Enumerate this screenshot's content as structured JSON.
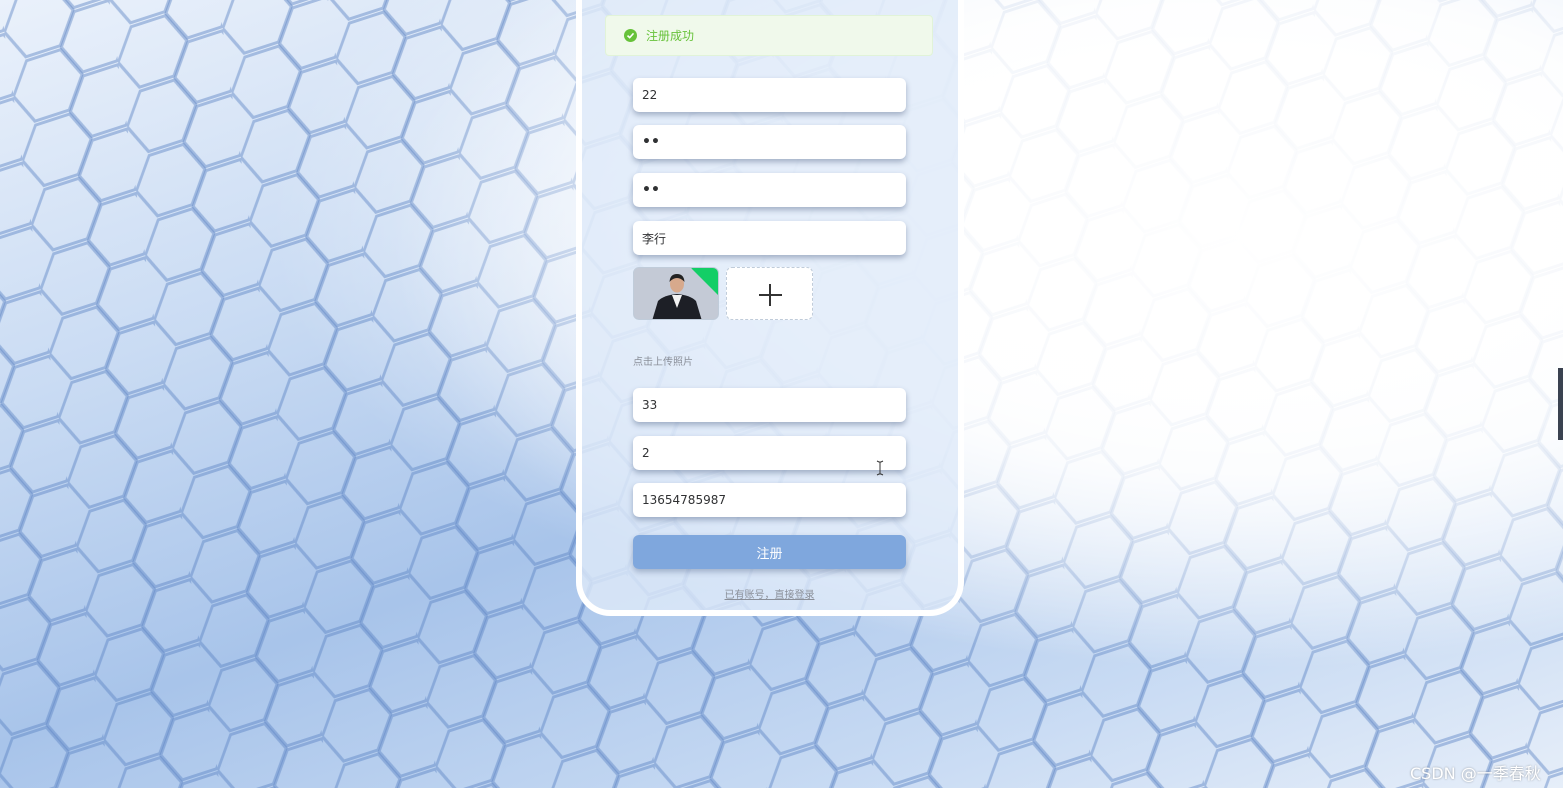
{
  "alert": {
    "message": "注册成功",
    "icon": "check-circle-icon"
  },
  "form": {
    "username_value": "22",
    "password_value": "••",
    "confirm_password_value": "••",
    "name_value": "李行",
    "upload_hint": "点击上传照片",
    "age_value": "33",
    "field_value_2": "2",
    "phone_value": "13654785987",
    "submit_label": "注册",
    "login_link": "已有账号，直接登录"
  },
  "watermark": "CSDN @一季春秋",
  "colors": {
    "success": "#67c23a",
    "submit_button": "#7fa7dd",
    "upload_badge": "#13ce66"
  }
}
